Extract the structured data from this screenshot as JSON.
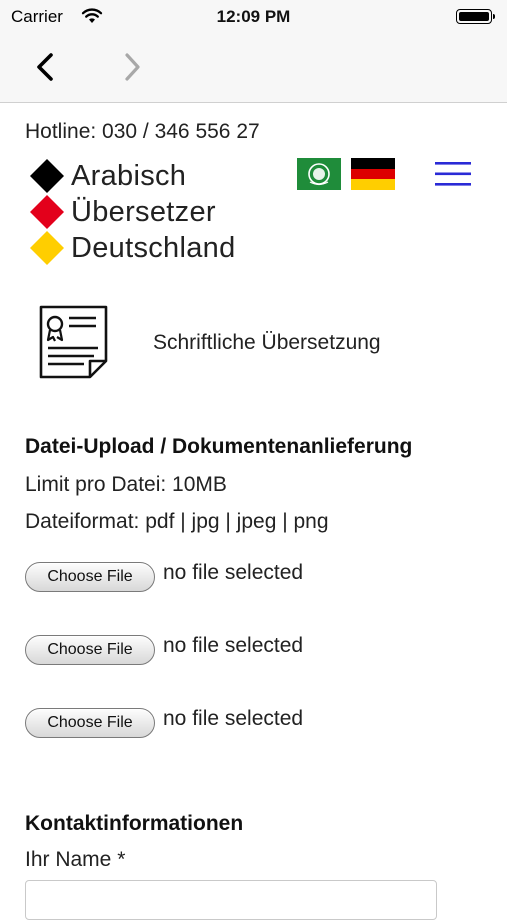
{
  "status_bar": {
    "carrier": "Carrier",
    "time": "12:09 PM"
  },
  "header": {
    "hotline": "Hotline: 030 / 346 556 27",
    "logo_lines": [
      "Arabisch",
      "Übersetzer",
      "Deutschland"
    ],
    "logo_colors": [
      "#000000",
      "#e3001b",
      "#ffce00"
    ]
  },
  "service": {
    "label": "Schriftliche Übersetzung"
  },
  "upload": {
    "heading": "Datei-Upload / Dokumentenanlieferung",
    "limit": "Limit pro Datei: 10MB",
    "formats": "Dateiformat: pdf | jpg | jpeg | png",
    "files": [
      {
        "button": "Choose File",
        "status": "no file selected"
      },
      {
        "button": "Choose File",
        "status": "no file selected"
      },
      {
        "button": "Choose File",
        "status": "no file selected"
      }
    ]
  },
  "contact": {
    "heading": "Kontaktinformationen",
    "name_label": "Ihr Name *"
  },
  "icons": {
    "back": "chevron-left-icon",
    "forward": "chevron-right-icon",
    "menu": "hamburger-menu-icon",
    "document": "certificate-document-icon"
  },
  "colors": {
    "menu_accent": "#2a2ad6",
    "nav_background": "#f7f7f7"
  }
}
